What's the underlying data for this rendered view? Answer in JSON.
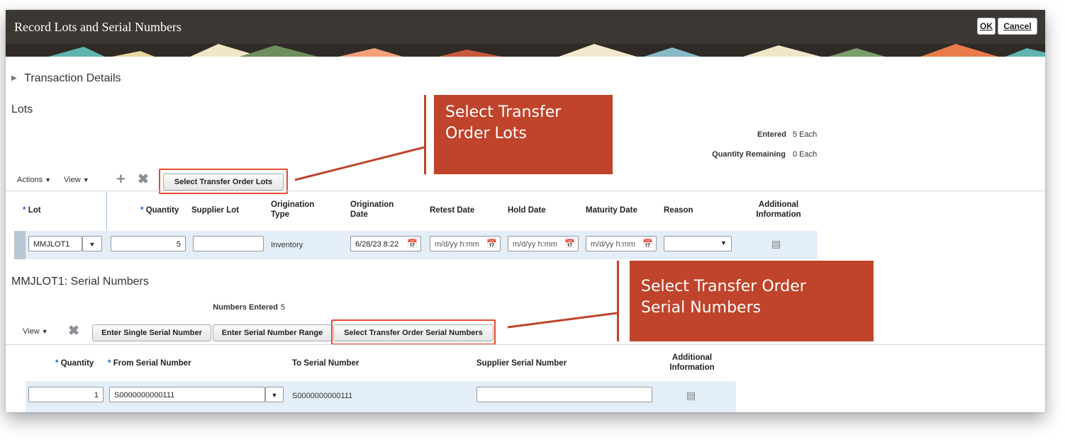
{
  "window": {
    "title": "Record Lots and Serial Numbers",
    "ok_label": "OK",
    "cancel_label": "Cancel"
  },
  "transaction_details": "Transaction Details",
  "lots": {
    "heading": "Lots",
    "entered_label": "Entered",
    "entered_value": "5 Each",
    "remaining_label": "Quantity Remaining",
    "remaining_value": "0 Each",
    "toolbar": {
      "actions": "Actions",
      "view": "View",
      "select_lots_button": "Select Transfer Order Lots"
    },
    "columns": {
      "lot": "Lot",
      "quantity": "Quantity",
      "supplier_lot": "Supplier Lot",
      "origination_type_1": "Origination",
      "origination_type_2": "Type",
      "origination_date_1": "Origination",
      "origination_date_2": "Date",
      "retest_date": "Retest Date",
      "hold_date": "Hold Date",
      "maturity_date": "Maturity Date",
      "reason": "Reason",
      "additional_1": "Additional",
      "additional_2": "Information"
    },
    "row": {
      "lot": "MMJLOT1",
      "quantity": "5",
      "supplier_lot": "",
      "origination_type": "Inventory",
      "origination_date": "6/28/23 8:22",
      "retest_placeholder": "m/d/yy h:mm",
      "hold_placeholder": "m/d/yy h:mm",
      "maturity_placeholder": "m/d/yy h:mm",
      "reason": ""
    }
  },
  "serials": {
    "heading": "MMJLOT1: Serial Numbers",
    "numbers_entered_label": "Numbers Entered",
    "numbers_entered_value": "5",
    "toolbar": {
      "view": "View",
      "enter_single": "Enter Single Serial Number",
      "enter_range": "Enter Serial Number Range",
      "select_serials": "Select Transfer Order Serial Numbers"
    },
    "columns": {
      "quantity": "Quantity",
      "from_serial": "From Serial Number",
      "to_serial": "To Serial Number",
      "supplier_serial": "Supplier Serial Number",
      "additional_1": "Additional",
      "additional_2": "Information"
    },
    "row": {
      "quantity": "1",
      "from_serial": "S0000000000111",
      "to_serial": "S0000000000111",
      "supplier_serial": ""
    }
  },
  "callouts": {
    "lots": {
      "line1": "Select Transfer",
      "line2": "Order Lots"
    },
    "serials": {
      "line1": "Select Transfer Order",
      "line2": "Serial Numbers"
    }
  },
  "colors": {
    "accent": "#c0432b",
    "highlight": "#e44a2f",
    "row": "#e3eef9",
    "required": "#1a62c1"
  }
}
